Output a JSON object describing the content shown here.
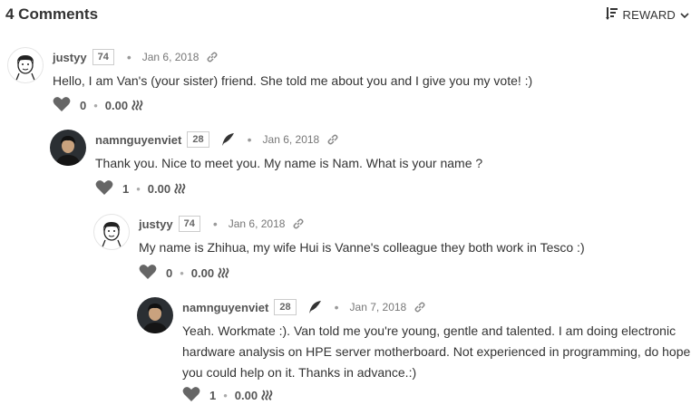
{
  "header": {
    "title": "4 Comments",
    "sort_label": "REWARD"
  },
  "comments": [
    {
      "author": "justyy",
      "reputation": "74",
      "date": "Jan 6, 2018",
      "body": [
        "Hello, I am Van's (your sister) friend. She told me about you and I give you my vote! :)"
      ],
      "votes": "0",
      "payout": "0.00"
    },
    {
      "author": "namnguyenviet",
      "reputation": "28",
      "date": "Jan 6, 2018",
      "body": [
        "Thank you. Nice to meet you. My name is Nam. What is your name ?"
      ],
      "votes": "1",
      "payout": "0.00"
    },
    {
      "author": "justyy",
      "reputation": "74",
      "date": "Jan 6, 2018",
      "body": [
        "My name is Zhihua, my wife Hui is Vanne's colleague they both work in Tesco :)"
      ],
      "votes": "0",
      "payout": "0.00"
    },
    {
      "author": "namnguyenviet",
      "reputation": "28",
      "date": "Jan 7, 2018",
      "body": [
        "Yeah. Workmate :). Van told me you're young, gentle and talented. I am doing electronic",
        "hardware analysis on HPE server motherboard. Not experienced in programming, do hope",
        "you could help on it. Thanks in advance.:)"
      ],
      "votes": "1",
      "payout": "0.00"
    }
  ]
}
